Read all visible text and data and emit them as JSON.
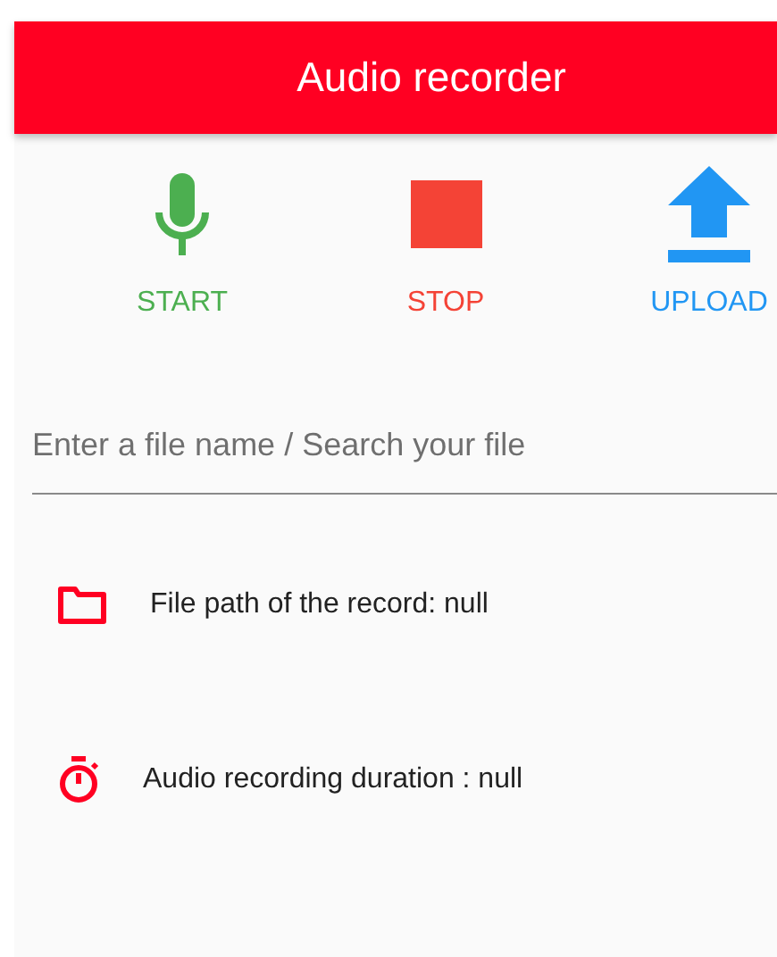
{
  "app_bar": {
    "title": "Audio recorder"
  },
  "actions": [
    {
      "kind": "mic",
      "label": "START",
      "color": "#4caf50"
    },
    {
      "kind": "stop",
      "label": "STOP",
      "color": "#f44336"
    },
    {
      "kind": "upload",
      "label": "UPLOAD",
      "color": "#2196f3"
    }
  ],
  "file_field": {
    "placeholder": "Enter a file name / Search your file"
  },
  "info": [
    {
      "kind": "folder",
      "text": "File path of the record: null"
    },
    {
      "kind": "timer",
      "text": "Audio recording duration : null"
    }
  ]
}
